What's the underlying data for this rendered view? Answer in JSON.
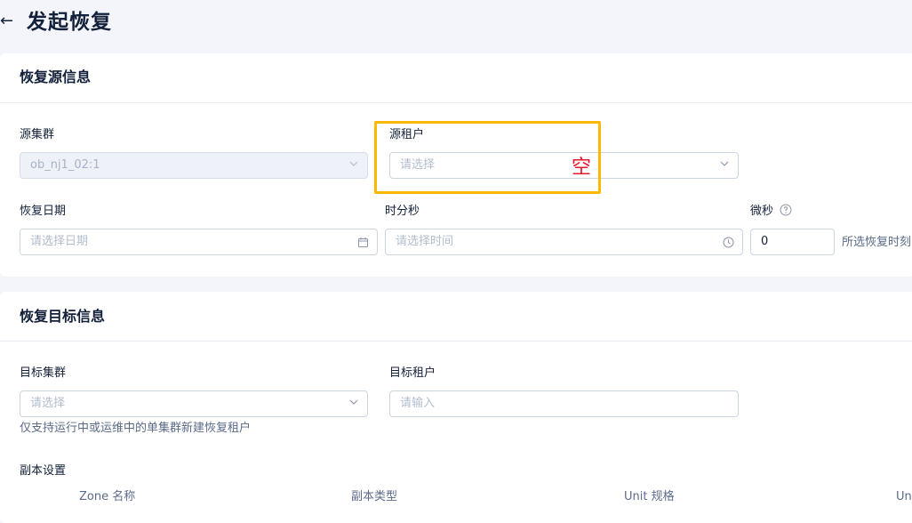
{
  "header": {
    "title": "发起恢复"
  },
  "source_section": {
    "title": "恢复源信息",
    "cluster": {
      "label": "源集群",
      "value": "ob_nj1_02:1"
    },
    "tenant": {
      "label": "源租户",
      "placeholder": "请选择"
    },
    "date": {
      "label": "恢复日期",
      "placeholder": "请选择日期"
    },
    "time": {
      "label": "时分秒",
      "placeholder": "请选择时间"
    },
    "microsecond": {
      "label": "微秒",
      "value": "0",
      "hint": "所选恢复时刻"
    }
  },
  "annotation": {
    "text": "空",
    "color": "#e8192c",
    "box_color": "#ffb800"
  },
  "target_section": {
    "title": "恢复目标信息",
    "cluster": {
      "label": "目标集群",
      "placeholder": "请选择",
      "help": "仅支持运行中或运维中的单集群新建恢复租户"
    },
    "tenant": {
      "label": "目标租户",
      "placeholder": "请输入"
    },
    "replica": {
      "label": "副本设置",
      "columns": [
        "Zone 名称",
        "副本类型",
        "Unit 规格",
        "Un"
      ]
    }
  },
  "icons": {
    "back": "arrow-left-icon",
    "select": "chevron-down-icon",
    "calendar": "calendar-icon",
    "clock": "clock-icon",
    "help": "question-circle-icon"
  }
}
